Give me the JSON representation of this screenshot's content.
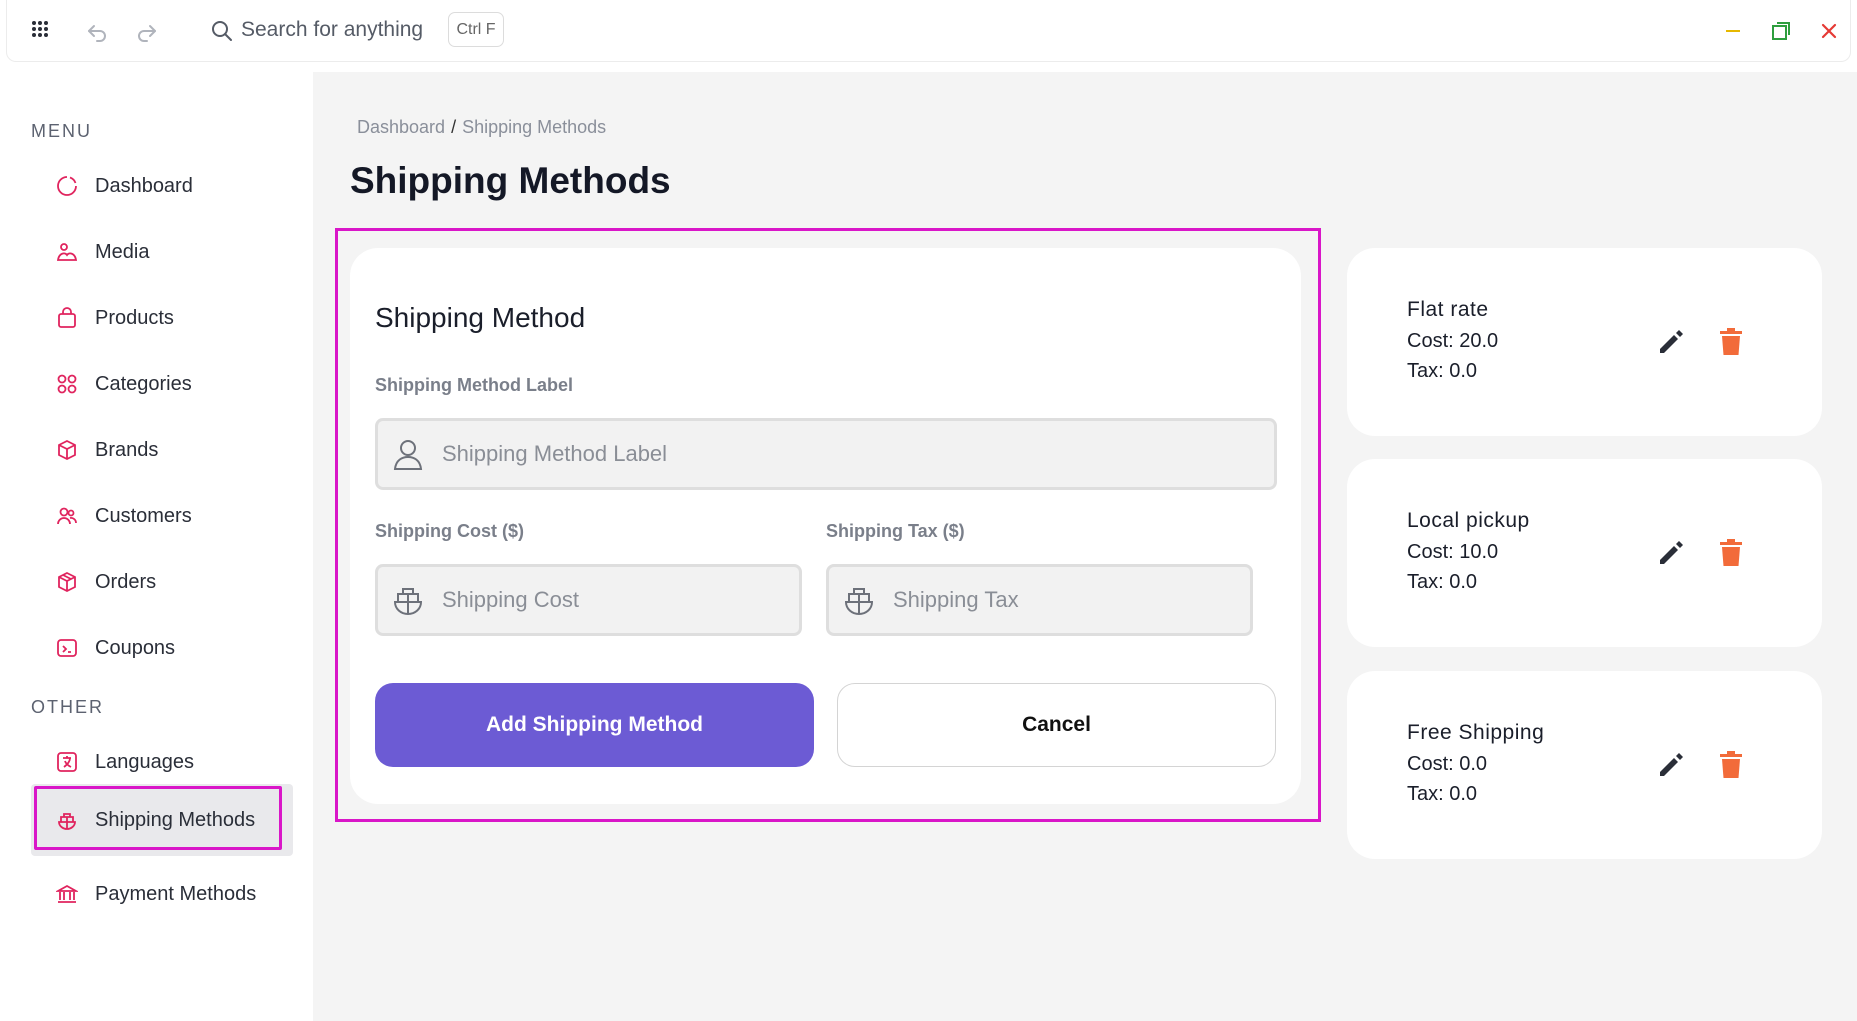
{
  "topbar": {
    "search_placeholder": "Search for anything",
    "shortcut": "Ctrl F",
    "icons": [
      "grid-icon",
      "undo-icon",
      "redo-icon",
      "search-icon",
      "minimize-icon",
      "maximize-icon",
      "close-icon"
    ]
  },
  "sidebar": {
    "menu_label": "MENU",
    "other_label": "OTHER",
    "menu_items": [
      {
        "label": "Dashboard",
        "icon": "circle-icon"
      },
      {
        "label": "Media",
        "icon": "media-icon"
      },
      {
        "label": "Products",
        "icon": "bag-icon"
      },
      {
        "label": "Categories",
        "icon": "categories-icon"
      },
      {
        "label": "Brands",
        "icon": "cube-icon"
      },
      {
        "label": "Customers",
        "icon": "users-icon"
      },
      {
        "label": "Orders",
        "icon": "box-icon"
      },
      {
        "label": "Coupons",
        "icon": "coupon-icon"
      }
    ],
    "other_items": [
      {
        "label": "Languages",
        "icon": "language-icon"
      },
      {
        "label": "Shipping Methods",
        "icon": "ship-icon",
        "active": true
      },
      {
        "label": "Payment Methods",
        "icon": "bank-icon"
      }
    ]
  },
  "main": {
    "breadcrumb": {
      "root": "Dashboard",
      "separator": "/",
      "current": "Shipping Methods"
    },
    "title": "Shipping Methods",
    "form": {
      "title": "Shipping Method",
      "label_field_label": "Shipping Method Label",
      "label_placeholder": "Shipping Method Label",
      "cost_field_label": "Shipping Cost ($)",
      "cost_placeholder": "Shipping Cost",
      "tax_field_label": "Shipping Tax ($)",
      "tax_placeholder": "Shipping Tax",
      "submit_label": "Add Shipping Method",
      "cancel_label": "Cancel"
    },
    "methods": [
      {
        "name": "Flat rate",
        "cost": "Cost: 20.0",
        "tax": "Tax: 0.0"
      },
      {
        "name": "Local pickup",
        "cost": "Cost: 10.0",
        "tax": "Tax: 0.0"
      },
      {
        "name": "Free Shipping",
        "cost": "Cost: 0.0",
        "tax": "Tax: 0.0"
      }
    ]
  },
  "colors": {
    "accent": "#6c5bd4",
    "highlight": "#d916c8",
    "sidebar_icon": "#e0245e",
    "delete": "#f26b3a",
    "minimize": "#e6b800",
    "maximize": "#2e9e3e",
    "close": "#e53935"
  }
}
